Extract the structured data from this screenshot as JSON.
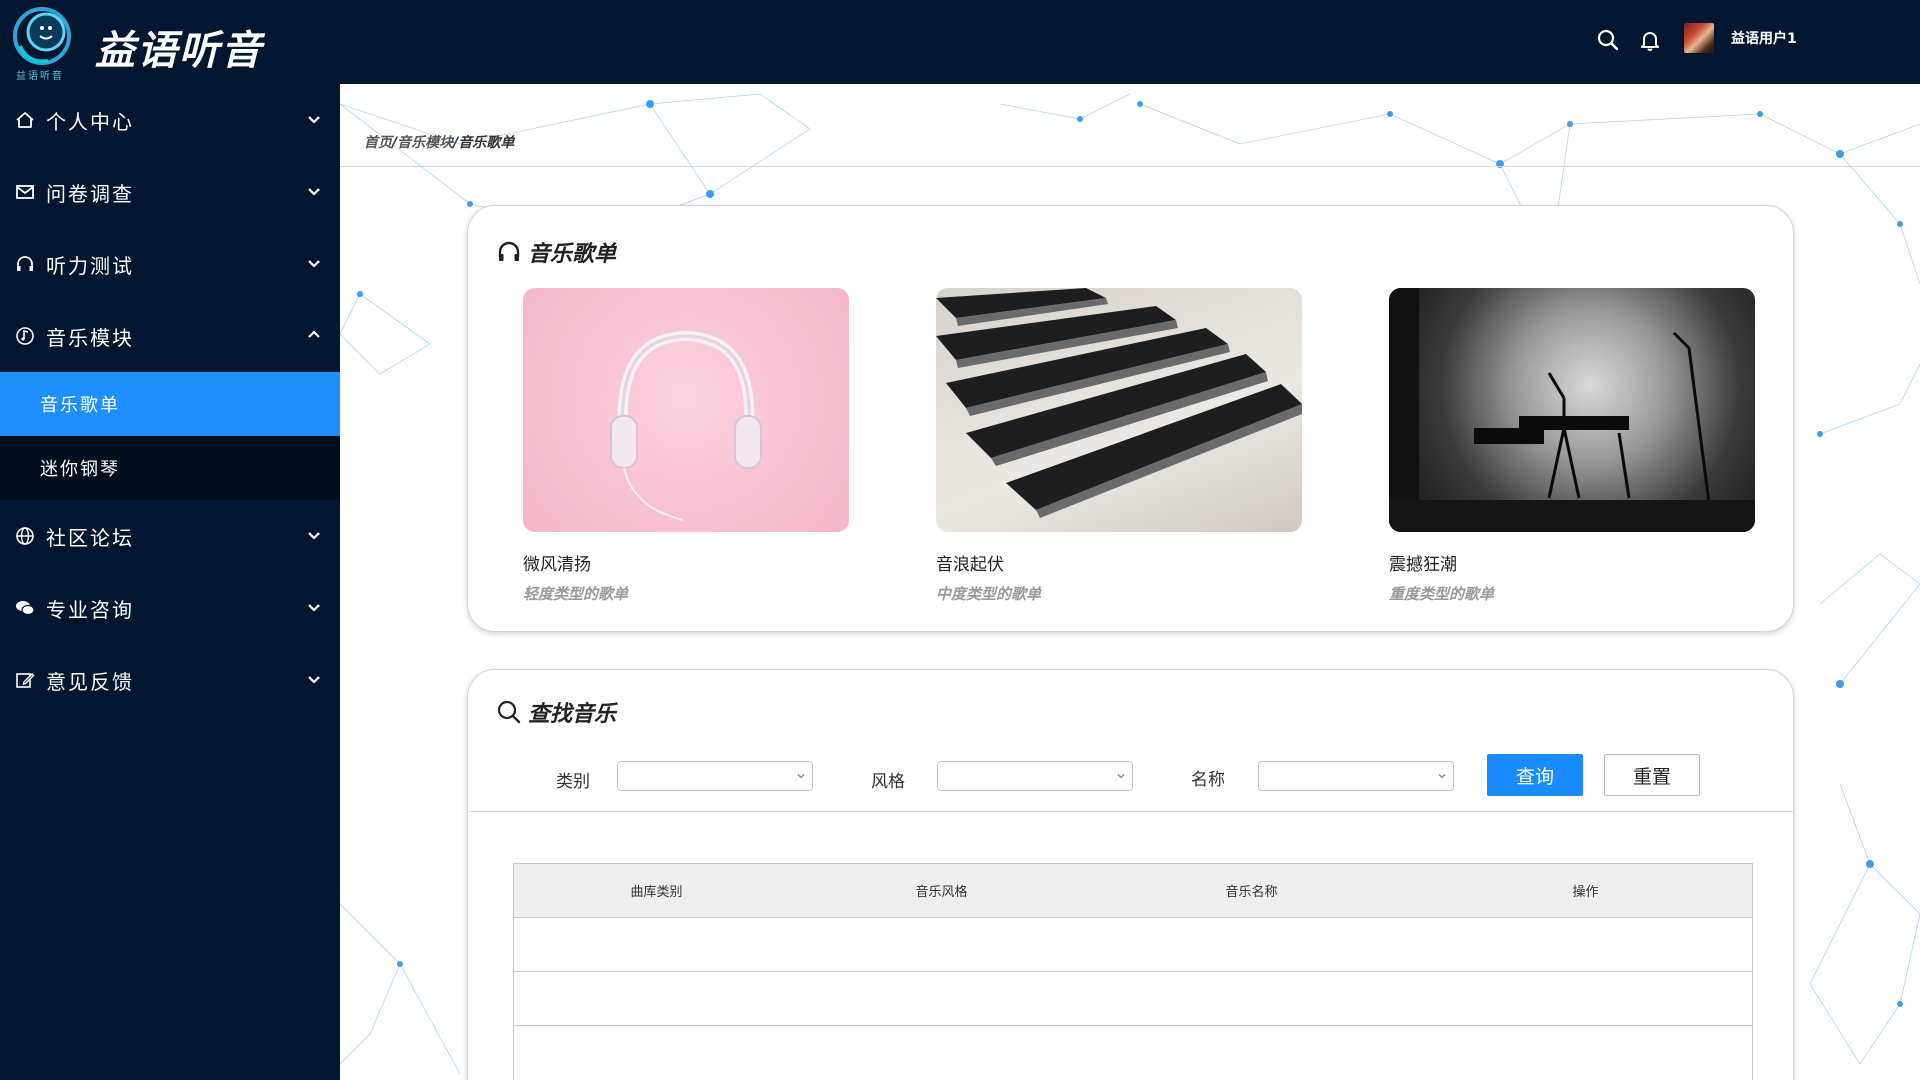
{
  "app": {
    "brand": "益语听音",
    "logo_sub": "益语听音",
    "username": "益语用户1"
  },
  "sidebar": {
    "items": [
      {
        "label": "个人中心",
        "icon": "home-icon"
      },
      {
        "label": "问卷调查",
        "icon": "mail-icon"
      },
      {
        "label": "听力测试",
        "icon": "headphones-icon"
      },
      {
        "label": "音乐模块",
        "icon": "music-note-icon"
      },
      {
        "label": "社区论坛",
        "icon": "globe-icon"
      },
      {
        "label": "专业咨询",
        "icon": "chat-icon"
      },
      {
        "label": "意见反馈",
        "icon": "edit-icon"
      }
    ],
    "music_sub": [
      {
        "label": "音乐歌单",
        "active": true
      },
      {
        "label": "迷你钢琴",
        "active": false
      }
    ]
  },
  "breadcrumb": {
    "home": "首页",
    "module": "音乐模块",
    "current": "音乐歌单",
    "sep": "/"
  },
  "playlist_card": {
    "title": "音乐歌单",
    "items": [
      {
        "name": "微风清扬",
        "desc": "轻度类型的歌单"
      },
      {
        "name": "音浪起伏",
        "desc": "中度类型的歌单"
      },
      {
        "name": "震撼狂潮",
        "desc": "重度类型的歌单"
      }
    ]
  },
  "search_card": {
    "title": "查找音乐",
    "filters": {
      "category_label": "类别",
      "style_label": "风格",
      "name_label": "名称"
    },
    "query_button": "查询",
    "reset_button": "重置",
    "table_headers": [
      "曲库类别",
      "音乐风格",
      "音乐名称",
      "操作"
    ]
  },
  "colors": {
    "sidebar_bg": "#031630",
    "active_menu": "#1f8fff",
    "primary_button": "#1a8cff"
  }
}
